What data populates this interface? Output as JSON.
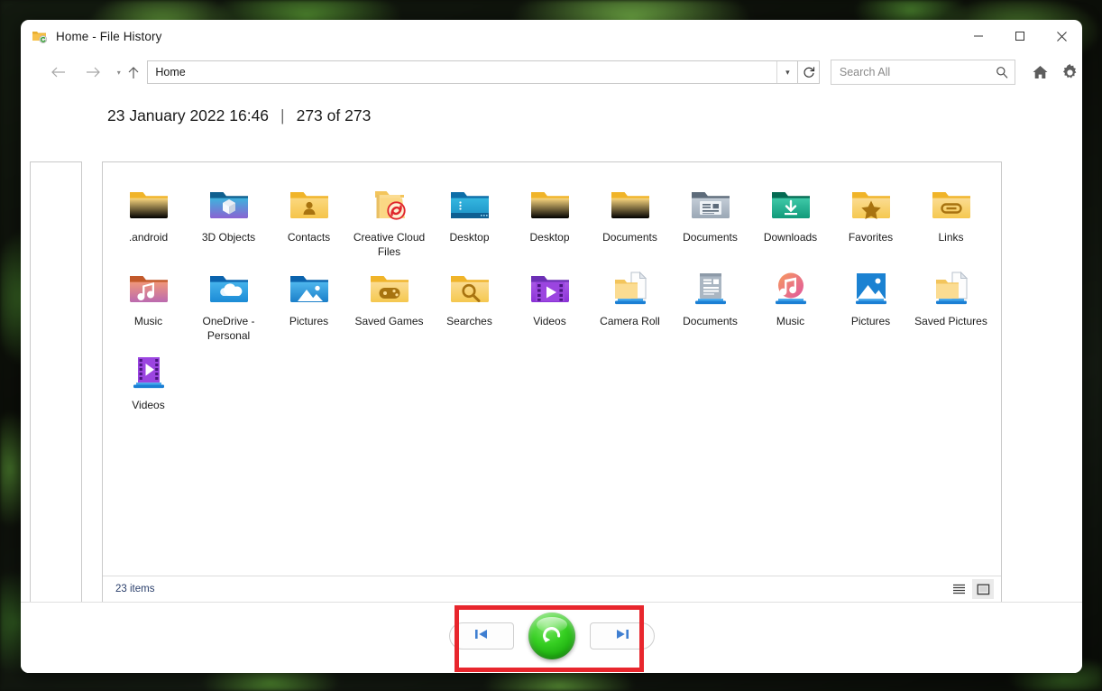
{
  "window": {
    "title": "Home - File History",
    "title_icon": "folder-history-icon",
    "controls": {
      "minimize": "minimize-icon",
      "maximize": "maximize-icon",
      "close": "close-icon"
    }
  },
  "navbar": {
    "back": "back-arrow-icon",
    "forward": "forward-arrow-icon",
    "recent": "recent-chevron-icon",
    "up": "up-arrow-icon",
    "address_value": "Home",
    "address_chevron": "chevron-down-icon",
    "refresh": "refresh-icon",
    "search_placeholder": "Search All",
    "search_value": "",
    "search_icon": "search-icon",
    "home_icon": "home-icon",
    "settings_icon": "gear-icon"
  },
  "header": {
    "timestamp": "23 January 2022 16:46",
    "separator": "|",
    "position": "273 of 273"
  },
  "items": [
    {
      "label": ".android",
      "icon": "folder-plain"
    },
    {
      "label": "3D Objects",
      "icon": "folder-3dobjects"
    },
    {
      "label": "Contacts",
      "icon": "folder-contacts"
    },
    {
      "label": "Creative Cloud Files",
      "icon": "folder-creative-cloud"
    },
    {
      "label": "Desktop",
      "icon": "folder-desktop-blue"
    },
    {
      "label": "Desktop",
      "icon": "folder-plain"
    },
    {
      "label": "Documents",
      "icon": "folder-plain"
    },
    {
      "label": "Documents",
      "icon": "folder-documents-gray"
    },
    {
      "label": "Downloads",
      "icon": "folder-downloads"
    },
    {
      "label": "Favorites",
      "icon": "folder-favorites"
    },
    {
      "label": "Links",
      "icon": "folder-links"
    },
    {
      "label": "Music",
      "icon": "folder-music"
    },
    {
      "label": "OneDrive - Personal",
      "icon": "folder-onedrive"
    },
    {
      "label": "Pictures",
      "icon": "folder-pictures"
    },
    {
      "label": "Saved Games",
      "icon": "folder-saved-games"
    },
    {
      "label": "Searches",
      "icon": "folder-searches"
    },
    {
      "label": "Videos",
      "icon": "folder-videos"
    },
    {
      "label": "Camera Roll",
      "icon": "library-camera-roll"
    },
    {
      "label": "Documents",
      "icon": "library-documents"
    },
    {
      "label": "Music",
      "icon": "library-music"
    },
    {
      "label": "Pictures",
      "icon": "library-pictures"
    },
    {
      "label": "Saved Pictures",
      "icon": "library-saved-pictures"
    },
    {
      "label": "Videos",
      "icon": "library-videos"
    }
  ],
  "statusbar": {
    "count": "23 items",
    "view_details_icon": "details-view-icon",
    "view_large_icon": "large-icons-view-icon",
    "selected_view": "large-icons-view-icon"
  },
  "bottom_controls": {
    "previous": "previous-version-icon",
    "restore": "restore-button-icon",
    "next": "next-version-icon"
  },
  "annotation": {
    "highlight_color": "#e8262d",
    "target": "bottom-controls"
  }
}
